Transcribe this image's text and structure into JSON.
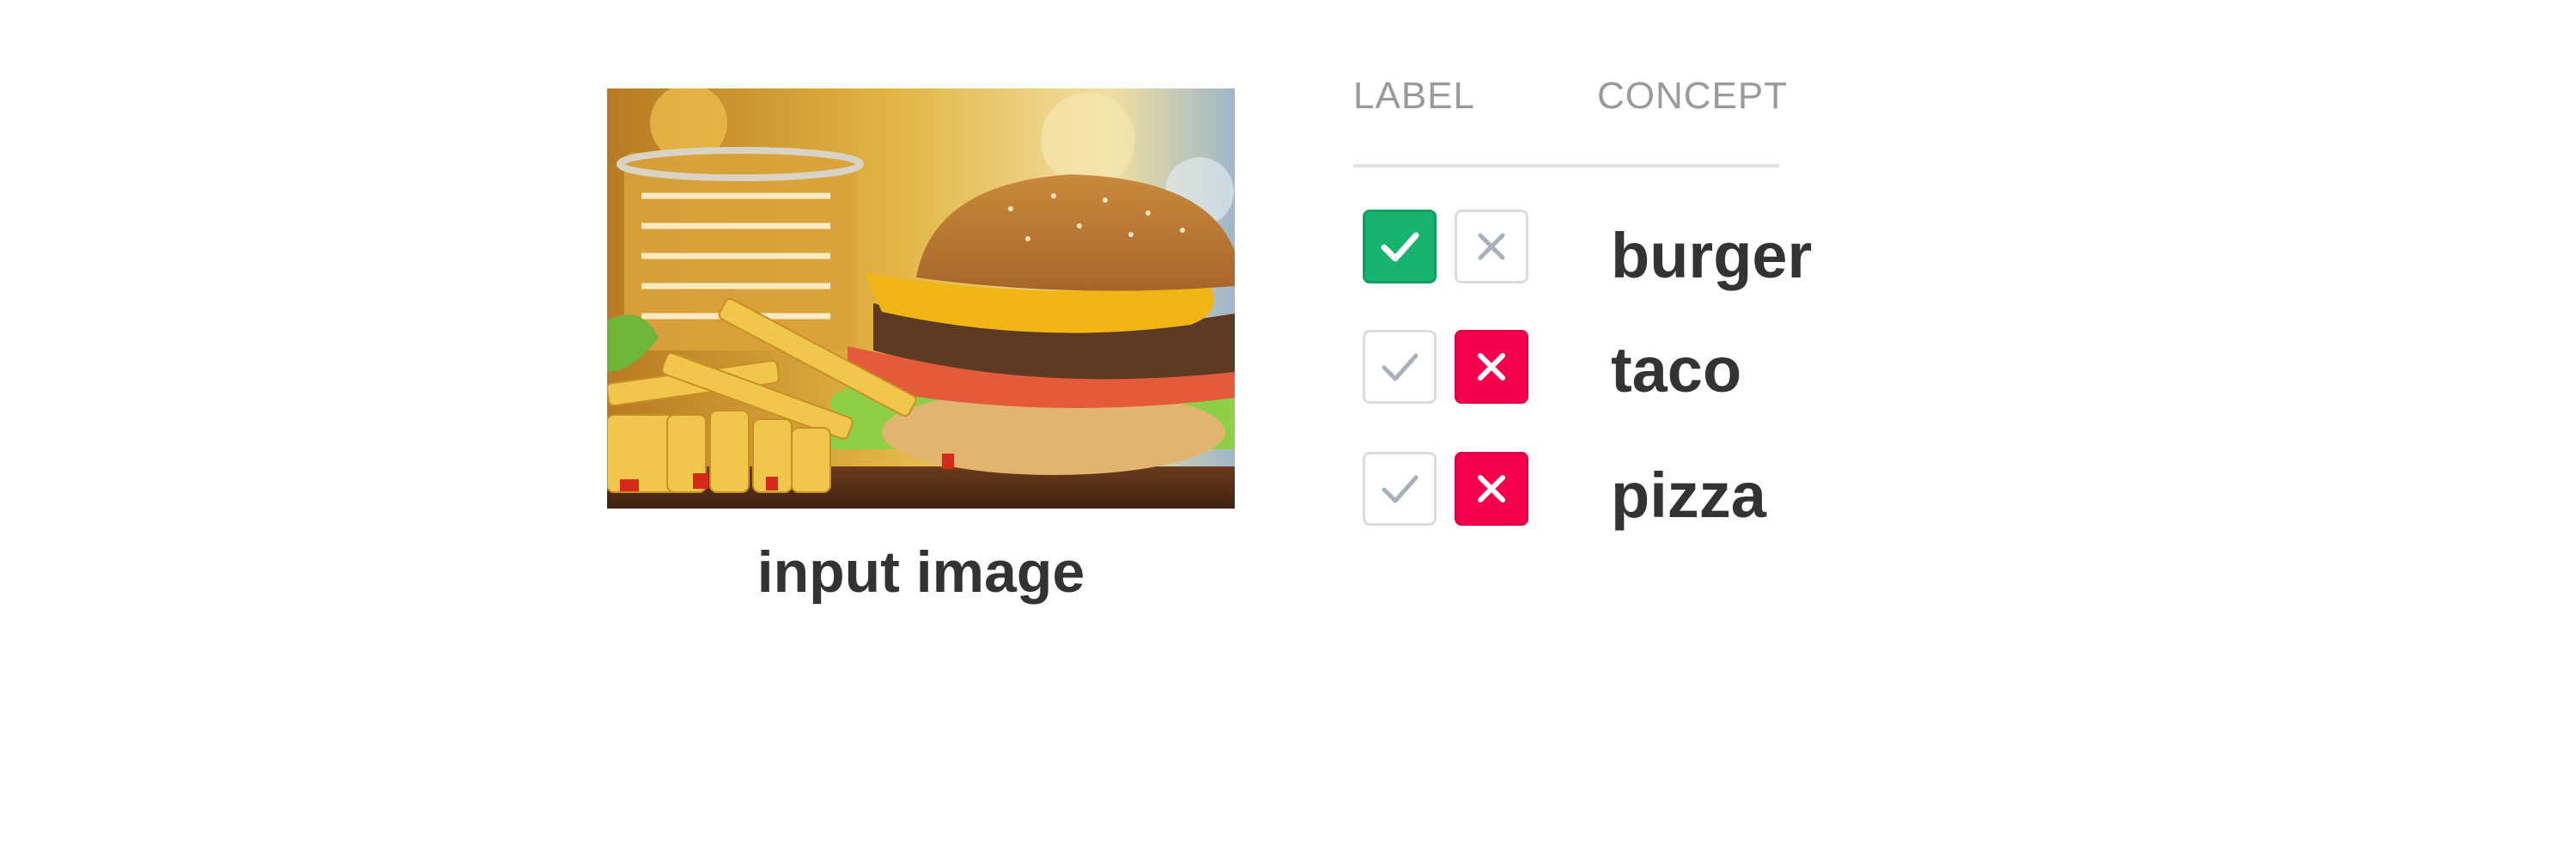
{
  "image": {
    "caption": "input image",
    "alt": "burger-with-fries-photo"
  },
  "table": {
    "header_label": "LABEL",
    "header_concept": "CONCEPT",
    "rows": [
      {
        "concept": "burger",
        "label": "yes"
      },
      {
        "concept": "taco",
        "label": "no"
      },
      {
        "concept": "pizza",
        "label": "no"
      }
    ]
  },
  "colors": {
    "yes_active": "#19b370",
    "no_active": "#f5004c",
    "inactive_border": "#dcdcdc",
    "inactive_glyph": "#a9b0bb",
    "text_dark": "#333333",
    "text_header": "#9a9a9a"
  },
  "icons": {
    "yes": "check-icon",
    "no": "x-icon"
  }
}
